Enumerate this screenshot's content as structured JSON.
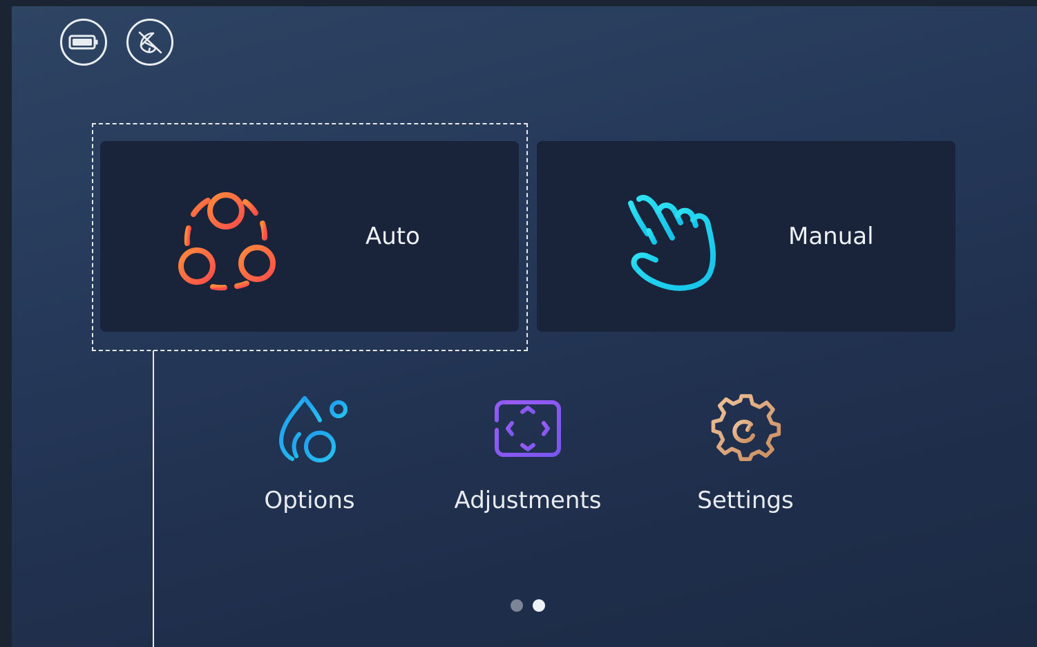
{
  "status_bar": {
    "battery_icon": "battery-icon",
    "signal_icon": "satellite-dish-off-icon"
  },
  "modes": [
    {
      "label": "Auto",
      "icon": "auto-cycle-icon",
      "color": "#ff6a3d",
      "focused": true
    },
    {
      "label": "Manual",
      "icon": "hand-pointer-icon",
      "color": "#22d4ef",
      "focused": false
    }
  ],
  "tiles": [
    {
      "label": "Options",
      "icon": "droplets-icon",
      "color": "#1fa8ee"
    },
    {
      "label": "Adjustments",
      "icon": "focus-frame-icon",
      "color": "#8a5cf5"
    },
    {
      "label": "Settings",
      "icon": "gear-icon",
      "color": "#d9a37a"
    }
  ],
  "pager": {
    "pages": 2,
    "active_page": 2
  }
}
